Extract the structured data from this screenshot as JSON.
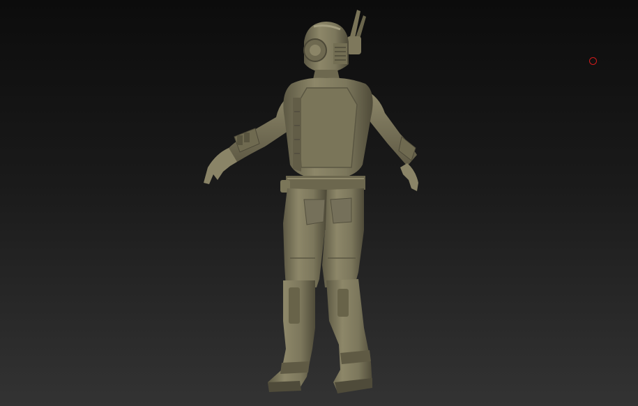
{
  "viewport": {
    "background_top": "#0c0c0c",
    "background_bottom": "#333333"
  },
  "model": {
    "subject": "sculpted-character-back-view",
    "material_color": "#8a8468",
    "shadow_color": "#55513f",
    "highlight_color": "#aaa485"
  },
  "cursor": {
    "icon": "brush-cursor-ring-icon",
    "color": "#d21c1c"
  }
}
